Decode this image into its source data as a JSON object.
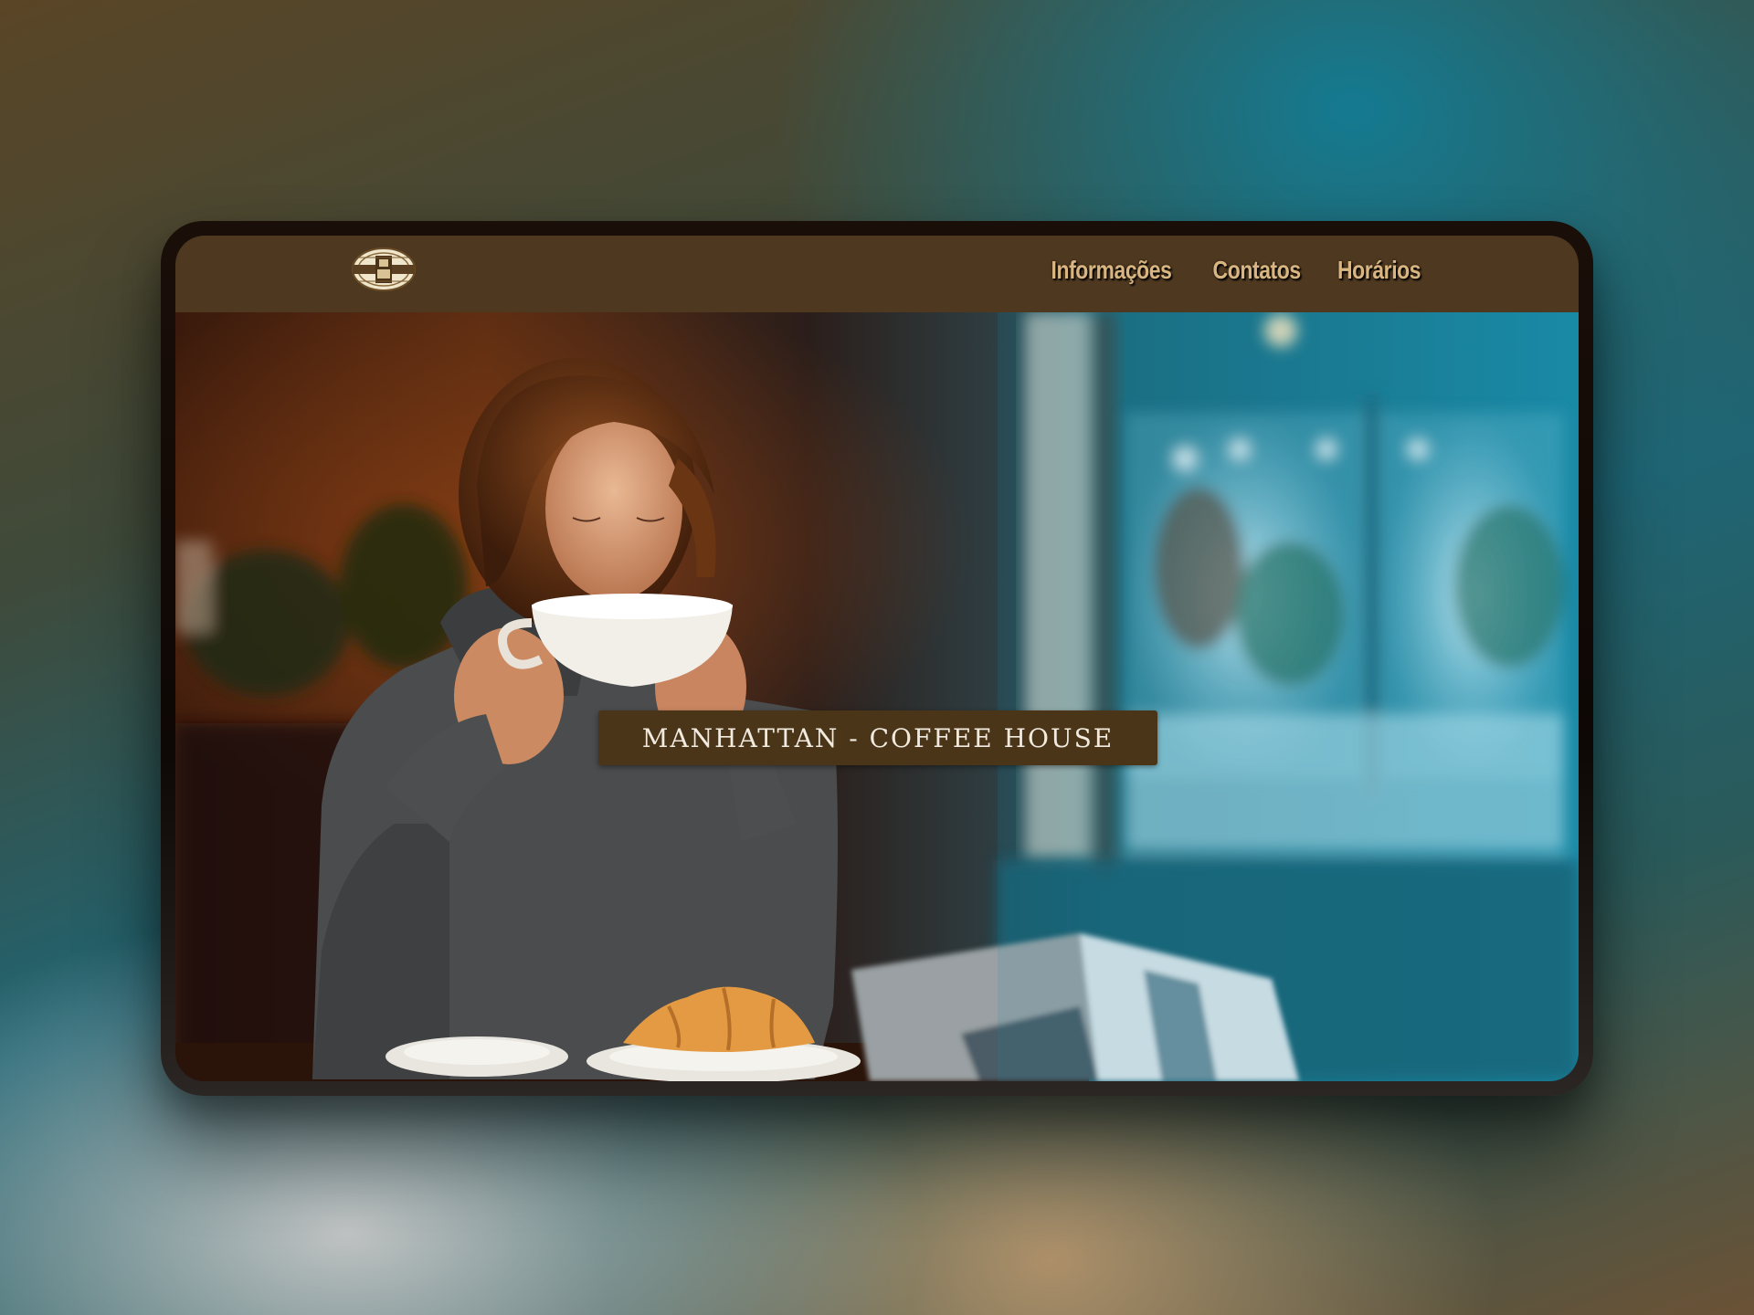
{
  "site": {
    "title": "MANHATTAN - COFFEE HOUSE",
    "logo_icon": "coffee-emblem-icon"
  },
  "nav": {
    "items": [
      {
        "label": "Informações"
      },
      {
        "label": "Contatos"
      },
      {
        "label": "Horários"
      }
    ]
  },
  "hero": {
    "image": "woman-drinking-coffee-photo"
  },
  "colors": {
    "header": "#4e3820",
    "nav_text": "#d9b681",
    "title_box": "#4b3519",
    "title_text": "#f1eadf"
  }
}
